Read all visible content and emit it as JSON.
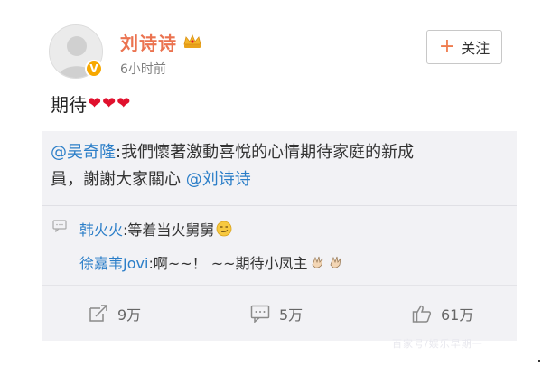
{
  "post": {
    "username": "刘诗诗",
    "time": "6小时前",
    "follow_label": "关注",
    "text": "期待",
    "hearts": [
      "❤",
      "❤",
      "❤"
    ],
    "verified_badge": "V"
  },
  "quote": {
    "mention": "@吴奇隆",
    "text_part1": ":我們懷著激動喜悅的心情期待家庭的新成",
    "text_part2": "員，謝謝大家關心",
    "mention_end": "@刘诗诗"
  },
  "comments": [
    {
      "user": "韩火火",
      "text": ":等着当火舅舅",
      "emoji": "smirk-emoji"
    },
    {
      "user": "徐嘉苇Jovi",
      "text": ":啊~~！ ~~期待小凤主",
      "emoji": "hand-emoji"
    }
  ],
  "actions": {
    "repost": "9万",
    "comment": "5万",
    "like": "61万"
  },
  "watermark": "百家号/娱乐早期一",
  "colors": {
    "username": "#eb7350",
    "link": "#2b7ec8",
    "quote_bg": "#f2f2f5",
    "heart": "#e0102d",
    "accent": "#ef7c4e"
  }
}
